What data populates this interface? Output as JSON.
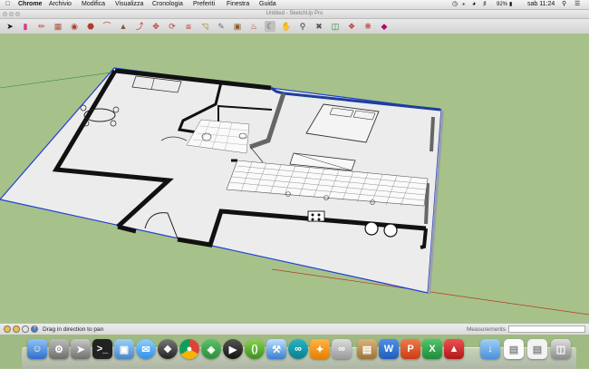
{
  "menubar": {
    "apple_icon": "apple-logo",
    "items": [
      "Chrome",
      "Archivio",
      "Modifica",
      "Visualizza",
      "Cronologia",
      "Preferiti",
      "Finestra",
      "Guida"
    ],
    "battery": "92%",
    "clock": "sab 11:24"
  },
  "window": {
    "title": "Untitled - SketchUp Pro"
  },
  "toolbar": {
    "tools": [
      "select-tool",
      "eraser-tool",
      "pencil-tool",
      "rectangle-tool",
      "circle-tool",
      "polygon-tool",
      "arc-tool",
      "push-pull-tool",
      "follow-me-tool",
      "move-tool",
      "rotate-tool",
      "scale-tool",
      "offset-tool",
      "tape-measure-tool",
      "text-tool",
      "paint-bucket-tool",
      "orbit-tool",
      "pan-tool",
      "zoom-tool",
      "zoom-extents-tool",
      "3d-warehouse-tool",
      "components-tool",
      "extension-tool",
      "ruby-tool"
    ]
  },
  "statusbar": {
    "hint": "Drag in direction to pan",
    "measurements_label": "Measurements",
    "measurements_value": ""
  },
  "dock": {
    "apps": [
      "finder",
      "system-preferences",
      "launchpad",
      "terminal",
      "preview",
      "messages",
      "safari",
      "chrome",
      "unity",
      "avid",
      "plants",
      "xcode",
      "arduino",
      "sublime",
      "glasses",
      "library",
      "word",
      "powerpoint",
      "excel",
      "sketchup",
      "downloads",
      "documents",
      "trash"
    ]
  },
  "colors": {
    "sky": "#a7c18a",
    "floor": "#ededed",
    "wall": "#111111",
    "selection": "#1f3fd6"
  }
}
